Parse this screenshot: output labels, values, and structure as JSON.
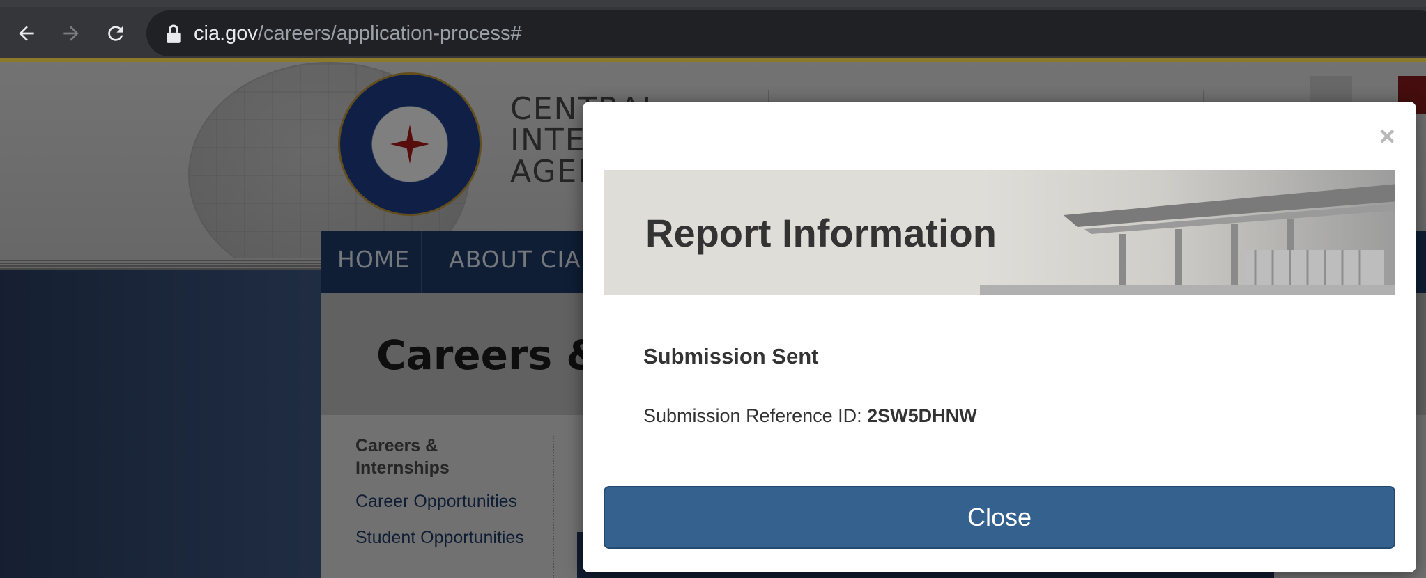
{
  "browser": {
    "url_host": "cia.gov",
    "url_path": "/careers/application-process#"
  },
  "site": {
    "agency_name": "CENTRAL\nINTELLIGENCE\nAGENCY",
    "nav": [
      "HOME",
      "ABOUT CIA"
    ],
    "page_title": "Careers & Internships",
    "sidebar": {
      "heading": "Careers & Internships",
      "links": [
        "Career Opportunities",
        "Student Opportunities"
      ]
    }
  },
  "modal": {
    "close_icon": "×",
    "banner_title": "Report Information",
    "subtitle": "Submission Sent",
    "ref_label": "Submission Reference ID:",
    "ref_id": "2SW5DHNW",
    "close_button": "Close"
  },
  "colors": {
    "modal_button": "#35618f",
    "nav_bar": "#1e3d6b",
    "overlay": "rgba(0,0,0,0.5)"
  }
}
